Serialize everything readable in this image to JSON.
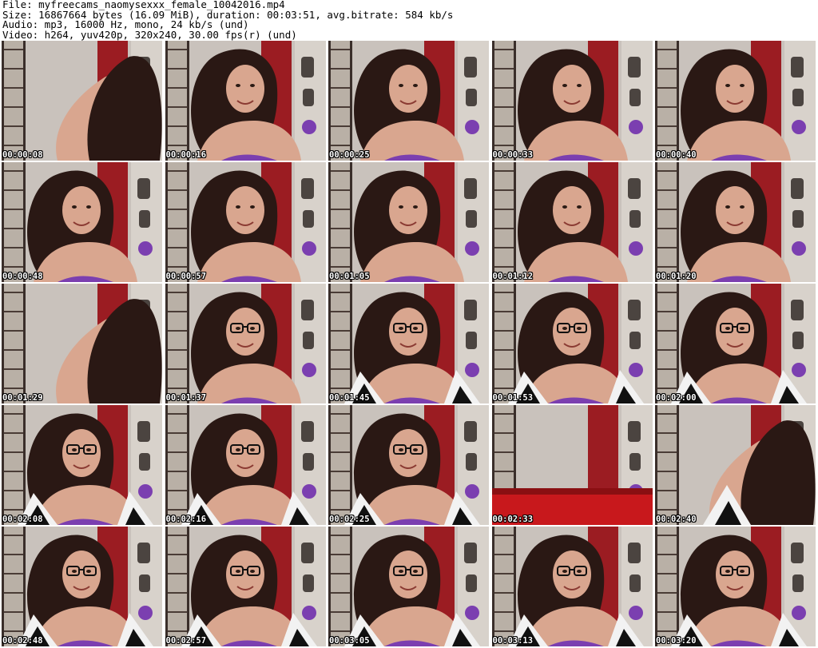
{
  "header": {
    "file_line": "File: myfreecams_naomysexxx_female_10042016.mp4",
    "size_line": "Size: 16867664 bytes (16.09 MiB), duration: 00:03:51, avg.bitrate: 584 kb/s",
    "audio_line": "Audio: mp3, 16000 Hz, mono, 24 kb/s (und)",
    "video_line": "Video: h264, yuv420p, 320x240, 30.00 fps(r) (und)"
  },
  "thumbnails": [
    {
      "time": "00:00:08",
      "scene": "hair-back"
    },
    {
      "time": "00:00:16",
      "scene": "face"
    },
    {
      "time": "00:00:25",
      "scene": "face"
    },
    {
      "time": "00:00:33",
      "scene": "face"
    },
    {
      "time": "00:00:40",
      "scene": "face"
    },
    {
      "time": "00:00:48",
      "scene": "face"
    },
    {
      "time": "00:00:57",
      "scene": "face"
    },
    {
      "time": "00:01:05",
      "scene": "face"
    },
    {
      "time": "00:01:12",
      "scene": "face"
    },
    {
      "time": "00:01:20",
      "scene": "face"
    },
    {
      "time": "00:01:29",
      "scene": "hair-back"
    },
    {
      "time": "00:01:37",
      "scene": "glasses"
    },
    {
      "time": "00:01:45",
      "scene": "glasses-cardigan"
    },
    {
      "time": "00:01:53",
      "scene": "glasses-cardigan"
    },
    {
      "time": "00:02:00",
      "scene": "glasses-cardigan"
    },
    {
      "time": "00:02:08",
      "scene": "glasses-cardigan"
    },
    {
      "time": "00:02:16",
      "scene": "glasses-cardigan"
    },
    {
      "time": "00:02:25",
      "scene": "glasses-cardigan"
    },
    {
      "time": "00:02:33",
      "scene": "empty-room"
    },
    {
      "time": "00:02:40",
      "scene": "hair-back-cardigan"
    },
    {
      "time": "00:02:48",
      "scene": "glasses-cardigan"
    },
    {
      "time": "00:02:57",
      "scene": "glasses-cardigan"
    },
    {
      "time": "00:03:05",
      "scene": "glasses-cardigan"
    },
    {
      "time": "00:03:13",
      "scene": "glasses-cardigan"
    },
    {
      "time": "00:03:20",
      "scene": "glasses-cardigan"
    }
  ],
  "colors": {
    "wall": "#c9c2bc",
    "red_curtain": "#9b1c22",
    "hair": "#2a1814",
    "skin": "#d9a68f",
    "purple": "#7b3fb0",
    "bed_red": "#c8181c"
  }
}
